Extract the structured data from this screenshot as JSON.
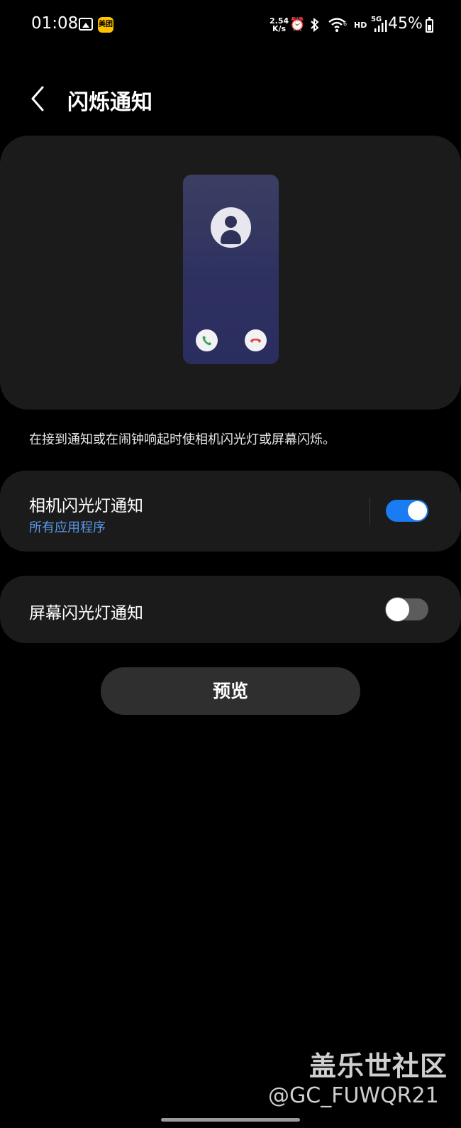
{
  "status_bar": {
    "time": "01:08",
    "notification_icons": [
      "gallery-icon",
      "meituan-app-icon"
    ],
    "meituan_label": "美团",
    "network_speed_value": "2.54",
    "network_speed_unit": "K/s",
    "hd_label": "HD",
    "network_type": "5G",
    "battery_percent": "45%"
  },
  "header": {
    "title": "闪烁通知"
  },
  "description": "在接到通知或在闹钟响起时使相机闪光灯或屏幕闪烁。",
  "settings": {
    "camera_flash": {
      "title": "相机闪光灯通知",
      "subtitle": "所有应用程序",
      "enabled": true
    },
    "screen_flash": {
      "title": "屏幕闪光灯通知",
      "enabled": false
    }
  },
  "preview_button_label": "预览",
  "watermark": {
    "title": "盖乐世社区",
    "handle": "@GC_FUWQR21"
  },
  "colors": {
    "accent": "#1a7cf3",
    "subtitle": "#5a9af0",
    "card_bg": "#1b1b1b",
    "accept_green": "#3aa35a",
    "decline_red": "#d9453a"
  }
}
